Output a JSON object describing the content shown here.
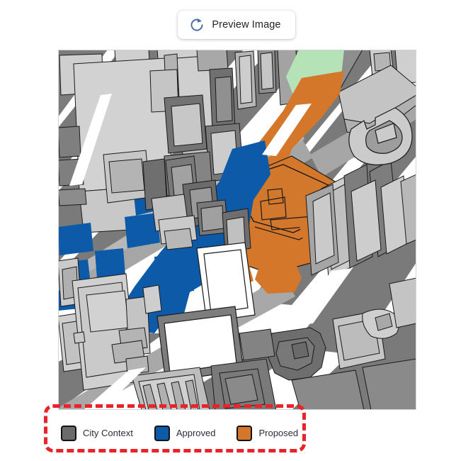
{
  "toolbar": {
    "preview_button_label": "Preview Image",
    "refresh_icon": "refresh-circular-arrow-icon",
    "icon_color": "#4a6f9e"
  },
  "map": {
    "type": "axonometric-city-massing-map",
    "background_color": "#ffffff",
    "palette": {
      "building_light": "#c9c9c9",
      "building_mid": "#b5b5b5",
      "shadow_dark": "#6e6e6e",
      "shadow_mid": "#8c8c8c",
      "street": "#9d9d9d",
      "outline": "#1a1a1a",
      "approved_blue": "#0d5ba8",
      "proposed_orange": "#d4772a",
      "park_green": "#b6e2b8",
      "white": "#ffffff"
    }
  },
  "legend": {
    "items": [
      {
        "label": "City Context",
        "color": "#6b6b6b",
        "border": "#111111"
      },
      {
        "label": "Approved",
        "color": "#0d5ba8",
        "border": "#111111"
      },
      {
        "label": "Proposed",
        "color": "#d4772a",
        "border": "#111111"
      }
    ]
  },
  "annotation": {
    "highlight_color": "#e8232a",
    "style": "dashed-rounded-rectangle",
    "target": "legend"
  }
}
